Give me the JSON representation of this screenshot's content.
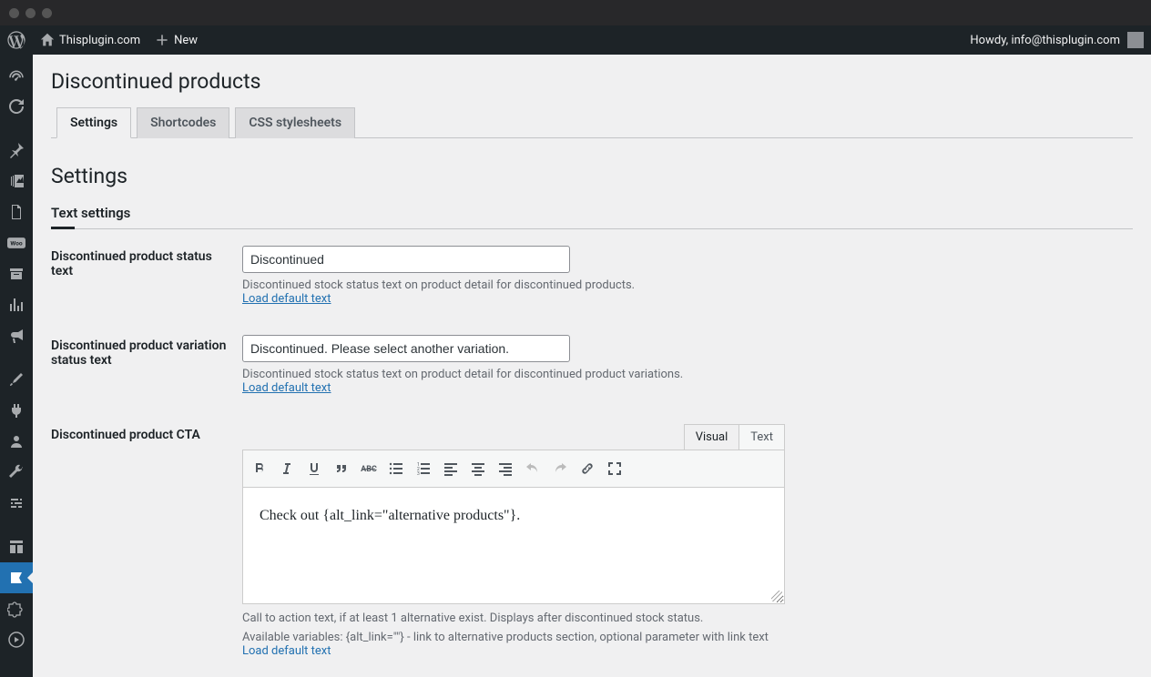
{
  "adminbar": {
    "site_name": "Thisplugin.com",
    "new_label": "New",
    "howdy": "Howdy, info@thisplugin.com"
  },
  "page": {
    "title": "Discontinued products",
    "tabs": [
      "Settings",
      "Shortcodes",
      "CSS stylesheets"
    ],
    "active_tab": 0,
    "section_title": "Settings",
    "subsection_title": "Text settings"
  },
  "fields": {
    "status_text": {
      "label": "Discontinued product status text",
      "value": "Discontinued",
      "description": "Discontinued stock status text on product detail for discontinued products.",
      "load_default": "Load default text"
    },
    "variation_status_text": {
      "label": "Discontinued product variation status text",
      "value": "Discontinued. Please select another variation.",
      "description": "Discontinued stock status text on product detail for discontinued product variations.",
      "load_default": "Load default text"
    },
    "cta": {
      "label": "Discontinued product CTA",
      "editor_tabs": {
        "visual": "Visual",
        "text": "Text"
      },
      "content": "Check out {alt_link=\"alternative products\"}.",
      "desc1": "Call to action text, if at least 1 alternative exist. Displays after discontinued stock status.",
      "desc2": "Available variables: {alt_link=\"\"} - link to alternative products section, optional parameter with link text",
      "load_default": "Load default text"
    }
  }
}
